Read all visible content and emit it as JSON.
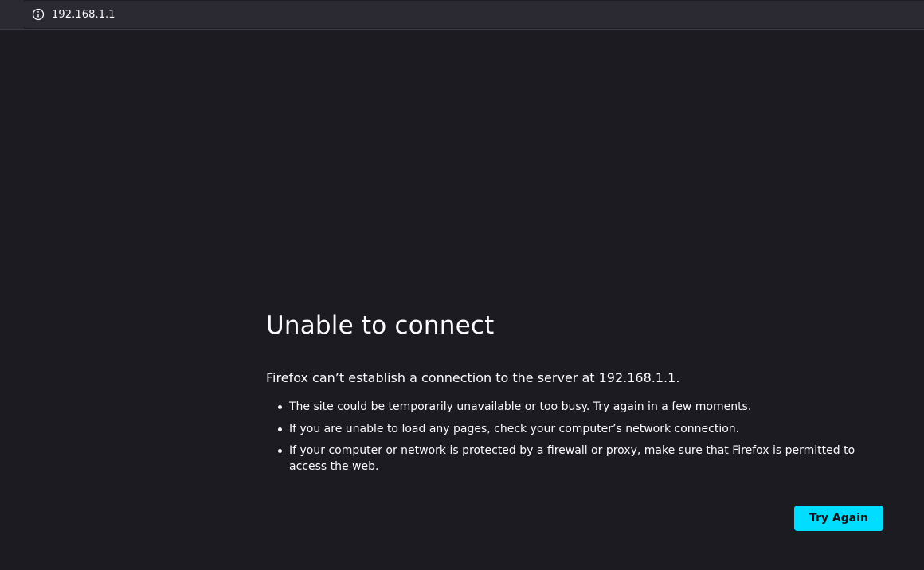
{
  "urlbar": {
    "info_icon": "info-icon",
    "url": "192.168.1.1"
  },
  "error": {
    "title": "Unable to connect",
    "lead": "Firefox can’t establish a connection to the server at 192.168.1.1.",
    "reasons": [
      "The site could be temporarily unavailable or too busy. Try again in a few moments.",
      "If you are unable to load any pages, check your computer’s network connection.",
      "If your computer or network is protected by a firewall or proxy, make sure that Firefox is permitted to access the web."
    ],
    "try_again_label": "Try Again"
  },
  "colors": {
    "background": "#1c1b22",
    "urlbar_background": "#2b2a33",
    "text": "#fbfbfe",
    "button_accent": "#00ddff"
  }
}
